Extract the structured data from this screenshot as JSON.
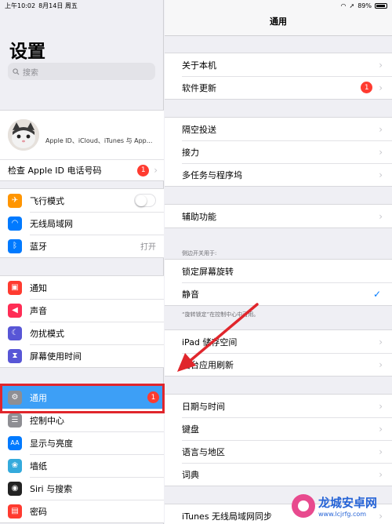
{
  "status": {
    "time": "上午10:02",
    "date": "8月14日 周五",
    "battery": "89%"
  },
  "left": {
    "title": "设置",
    "search_placeholder": "搜索",
    "profile_subtitle": "Apple ID、iCloud、iTunes 与 App...",
    "apple_id_row": {
      "label": "检查 Apple ID 电话号码",
      "badge": "1"
    },
    "group1": [
      {
        "label": "飞行模式",
        "icon": "airplane-icon",
        "color": "#ff9500",
        "glyph": "✈"
      },
      {
        "label": "无线局域网",
        "icon": "wifi-icon",
        "color": "#007aff",
        "glyph": "◠"
      },
      {
        "label": "蓝牙",
        "icon": "bluetooth-icon",
        "color": "#007aff",
        "glyph": "ᛒ",
        "value": "打开"
      }
    ],
    "group2": [
      {
        "label": "通知",
        "icon": "notifications-icon",
        "color": "#ff3b30",
        "glyph": "▣"
      },
      {
        "label": "声音",
        "icon": "sound-icon",
        "color": "#ff2d55",
        "glyph": "◀"
      },
      {
        "label": "勿扰模式",
        "icon": "moon-icon",
        "color": "#5856d6",
        "glyph": "☾"
      },
      {
        "label": "屏幕使用时间",
        "icon": "hourglass-icon",
        "color": "#5856d6",
        "glyph": "⧗"
      }
    ],
    "group3": [
      {
        "label": "通用",
        "icon": "gear-icon",
        "color": "#8e8e93",
        "glyph": "⚙",
        "badge": "1"
      },
      {
        "label": "控制中心",
        "icon": "control-center-icon",
        "color": "#8e8e93",
        "glyph": "☰"
      },
      {
        "label": "显示与亮度",
        "icon": "display-icon",
        "color": "#007aff",
        "glyph": "AA"
      },
      {
        "label": "墙纸",
        "icon": "wallpaper-icon",
        "color": "#34aadc",
        "glyph": "❀"
      },
      {
        "label": "Siri 与搜索",
        "icon": "siri-icon",
        "color": "#222",
        "glyph": "◉"
      },
      {
        "label": "密码",
        "icon": "lock-icon",
        "color": "#ff3b30",
        "glyph": "🔒"
      }
    ]
  },
  "right": {
    "nav_title": "通用",
    "group1": [
      {
        "label": "关于本机"
      },
      {
        "label": "软件更新",
        "badge": "1"
      }
    ],
    "group2": [
      {
        "label": "隔空投送"
      },
      {
        "label": "接力"
      },
      {
        "label": "多任务与程序坞"
      }
    ],
    "group3": [
      {
        "label": "辅助功能"
      }
    ],
    "side_switch_header": "侧边开关用于:",
    "group4": [
      {
        "label": "锁定屏幕旋转"
      },
      {
        "label": "静音"
      }
    ],
    "side_switch_footer": "“旋转锁定”在控制中心中可用。",
    "group5": [
      {
        "label": "iPad 储存空间"
      },
      {
        "label": "后台应用刷新"
      }
    ],
    "group6": [
      {
        "label": "日期与时间"
      },
      {
        "label": "键盘"
      },
      {
        "label": "语言与地区"
      },
      {
        "label": "词典"
      }
    ],
    "group7": [
      {
        "label": "iTunes 无线局域网同步"
      }
    ]
  },
  "watermark": {
    "title": "龙城安卓网",
    "url": "www.lcjrfg.com"
  },
  "colors": {
    "accent": "#007aff",
    "selection": "#3d9ff6",
    "badge": "#ff3b30",
    "highlight_box": "#e0262c",
    "annotation_arrow": "#e0262c"
  }
}
